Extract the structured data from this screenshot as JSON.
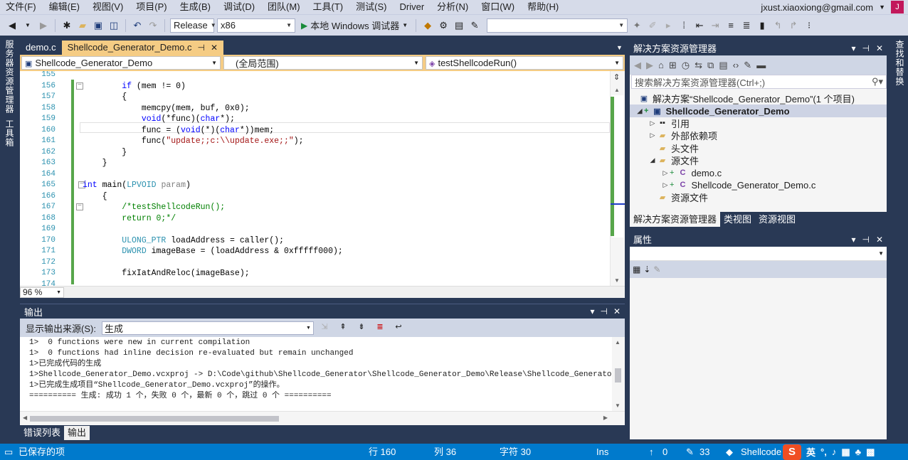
{
  "menu": {
    "items": [
      "文件(F)",
      "编辑(E)",
      "视图(V)",
      "项目(P)",
      "生成(B)",
      "调试(D)",
      "团队(M)",
      "工具(T)",
      "测试(S)",
      "Driver",
      "分析(N)",
      "窗口(W)",
      "帮助(H)"
    ],
    "user": "jxust.xiaoxiong@gmail.com",
    "avatar_letter": "J"
  },
  "toolbar": {
    "config": "Release",
    "platform": "x86",
    "run_label": "本地 Windows 调试器",
    "search_value": ""
  },
  "left_strip": {
    "server_explorer": "服务器资源管理器",
    "toolbox": "工具箱"
  },
  "right_strip": {
    "find_replace": "查找和替换"
  },
  "editor": {
    "tabs": [
      {
        "label": "demo.c"
      },
      {
        "label": "Shellcode_Generator_Demo.c"
      }
    ],
    "nav": {
      "project": "Shellcode_Generator_Demo",
      "scope": "(全局范围)",
      "member": "testShellcodeRun()"
    },
    "line_numbers": [
      "155",
      "156",
      "157",
      "158",
      "159",
      "160",
      "161",
      "162",
      "163",
      "164",
      "165",
      "166",
      "167",
      "168",
      "169",
      "170",
      "171",
      "172",
      "173",
      "174"
    ],
    "zoom": "96 %"
  },
  "output": {
    "title": "输出",
    "source_label": "显示输出来源(S):",
    "source_value": "生成",
    "lines": [
      "1>  0 functions were new in current compilation",
      "1>  0 functions had inline decision re-evaluated but remain unchanged",
      "1>已完成代码的生成",
      "1>Shellcode_Generator_Demo.vcxproj -> D:\\Code\\github\\Shellcode_Generator\\Shellcode_Generator_Demo\\Release\\Shellcode_Generator_Demo.exe",
      "1>已完成生成项目“Shellcode_Generator_Demo.vcxproj”的操作。",
      "========== 生成: 成功 1 个，失败 0 个，最新 0 个，跳过 0 个 =========="
    ],
    "tabs": [
      "错误列表",
      "输出"
    ]
  },
  "solution_explorer": {
    "title": "解决方案资源管理器",
    "search_placeholder": "搜索解决方案资源管理器(Ctrl+;)",
    "solution": "解决方案“Shellcode_Generator_Demo”(1 个项目)",
    "project": "Shellcode_Generator_Demo",
    "nodes": [
      "引用",
      "外部依赖项",
      "头文件",
      "源文件",
      "demo.c",
      "Shellcode_Generator_Demo.c",
      "资源文件"
    ],
    "tabs": [
      "解决方案资源管理器",
      "类视图",
      "资源视图"
    ]
  },
  "properties": {
    "title": "属性"
  },
  "status": {
    "saved": "已保存的项",
    "line": "行 160",
    "col": "列 36",
    "char": "字符 30",
    "mode": "Ins",
    "up_count": "0",
    "edit_count": "33",
    "branch": "Shellcode",
    "ime_lang": "英"
  }
}
